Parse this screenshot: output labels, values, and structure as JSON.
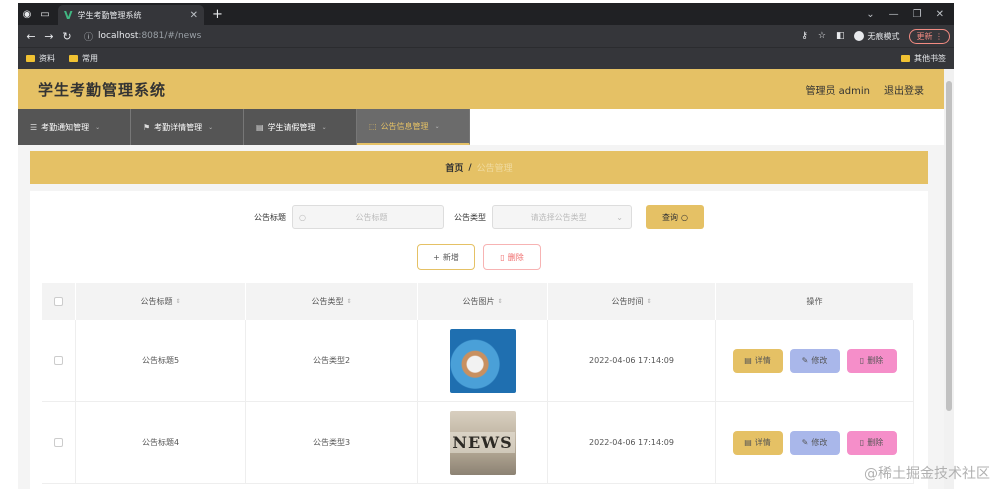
{
  "browser": {
    "tab_title": "学生考勤管理系统",
    "url_host": "localhost",
    "url_path": ":8081/#/news",
    "incognito_label": "无痕模式",
    "update_label": "更新",
    "bookmarks": [
      "资料",
      "常用"
    ],
    "other_bookmarks": "其他书签"
  },
  "header": {
    "title": "学生考勤管理系统",
    "user_label": "管理员 admin",
    "logout_label": "退出登录"
  },
  "menu": [
    {
      "label": "考勤通知管理",
      "icon": "notice-icon"
    },
    {
      "label": "考勤详情管理",
      "icon": "flag-icon"
    },
    {
      "label": "学生请假管理",
      "icon": "leave-icon"
    },
    {
      "label": "公告信息管理",
      "icon": "announcement-icon",
      "active": true
    }
  ],
  "breadcrumb": {
    "home": "首页",
    "separator": "/",
    "current": "公告管理"
  },
  "search": {
    "title_label": "公告标题",
    "title_placeholder": "公告标题",
    "type_label": "公告类型",
    "type_placeholder": "请选择公告类型",
    "query_label": "查询"
  },
  "actions": {
    "add_label": "新增",
    "delete_label": "删除"
  },
  "table": {
    "headers": [
      "公告标题",
      "公告类型",
      "公告图片",
      "公告时间",
      "操作"
    ],
    "rows": [
      {
        "title": "公告标题5",
        "type": "公告类型2",
        "image": "globe-image",
        "time": "2022-04-06 17:14:09"
      },
      {
        "title": "公告标题4",
        "type": "公告类型3",
        "image": "news-image",
        "time": "2022-04-06 17:14:09",
        "image_text": "NEWS"
      }
    ],
    "op_detail": "详情",
    "op_edit": "修改",
    "op_delete": "删除"
  },
  "watermark": "@稀土掘金技术社区",
  "colors": {
    "accent": "#e5c165",
    "menu_bg": "#555555",
    "edit": "#a9b7ea",
    "delete": "#f58ec9"
  }
}
